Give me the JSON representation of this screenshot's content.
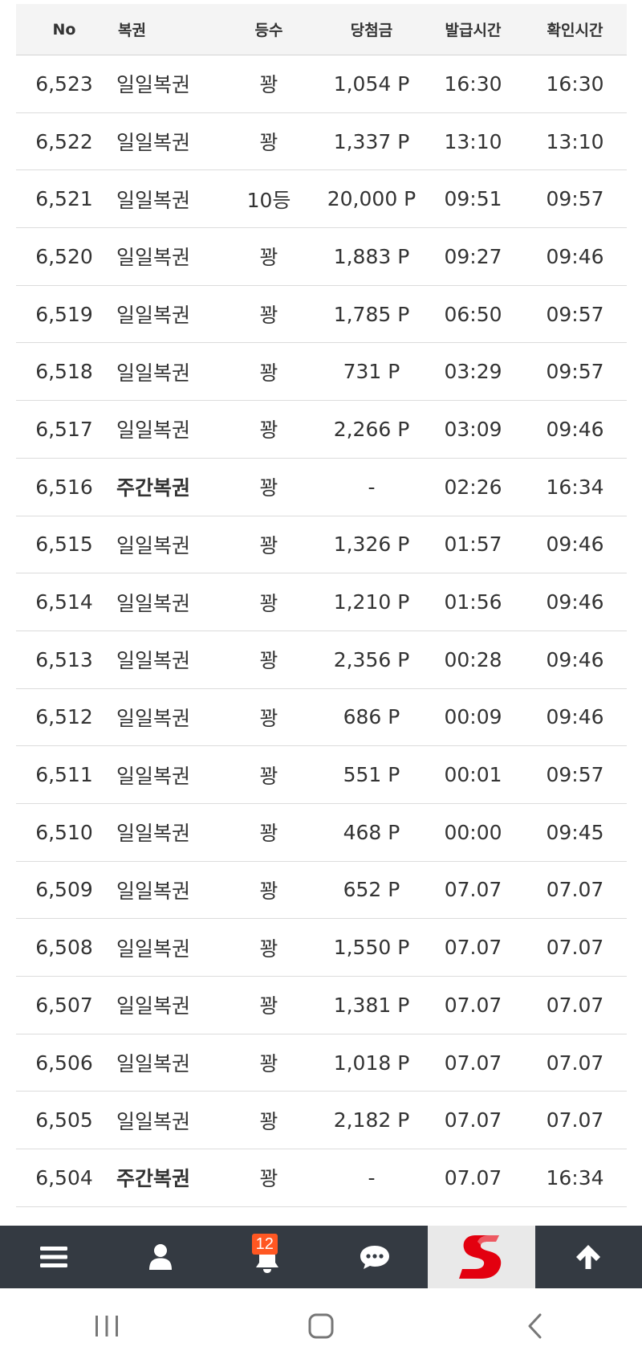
{
  "table": {
    "headers": {
      "no": "No",
      "type": "복권",
      "rank": "등수",
      "prize": "당첨금",
      "issued": "발급시간",
      "checked": "확인시간"
    },
    "rows": [
      {
        "no": "6,523",
        "type": "일일복권",
        "rank": "꽝",
        "prize": "1,054 P",
        "issued": "16:30",
        "checked": "16:30"
      },
      {
        "no": "6,522",
        "type": "일일복권",
        "rank": "꽝",
        "prize": "1,337 P",
        "issued": "13:10",
        "checked": "13:10"
      },
      {
        "no": "6,521",
        "type": "일일복권",
        "rank": "10등",
        "prize": "20,000 P",
        "issued": "09:51",
        "checked": "09:57"
      },
      {
        "no": "6,520",
        "type": "일일복권",
        "rank": "꽝",
        "prize": "1,883 P",
        "issued": "09:27",
        "checked": "09:46"
      },
      {
        "no": "6,519",
        "type": "일일복권",
        "rank": "꽝",
        "prize": "1,785 P",
        "issued": "06:50",
        "checked": "09:57"
      },
      {
        "no": "6,518",
        "type": "일일복권",
        "rank": "꽝",
        "prize": "731 P",
        "issued": "03:29",
        "checked": "09:57"
      },
      {
        "no": "6,517",
        "type": "일일복권",
        "rank": "꽝",
        "prize": "2,266 P",
        "issued": "03:09",
        "checked": "09:46"
      },
      {
        "no": "6,516",
        "type": "주간복권",
        "rank": "꽝",
        "prize": "-",
        "issued": "02:26",
        "checked": "16:34"
      },
      {
        "no": "6,515",
        "type": "일일복권",
        "rank": "꽝",
        "prize": "1,326 P",
        "issued": "01:57",
        "checked": "09:46"
      },
      {
        "no": "6,514",
        "type": "일일복권",
        "rank": "꽝",
        "prize": "1,210 P",
        "issued": "01:56",
        "checked": "09:46"
      },
      {
        "no": "6,513",
        "type": "일일복권",
        "rank": "꽝",
        "prize": "2,356 P",
        "issued": "00:28",
        "checked": "09:46"
      },
      {
        "no": "6,512",
        "type": "일일복권",
        "rank": "꽝",
        "prize": "686 P",
        "issued": "00:09",
        "checked": "09:46"
      },
      {
        "no": "6,511",
        "type": "일일복권",
        "rank": "꽝",
        "prize": "551 P",
        "issued": "00:01",
        "checked": "09:57"
      },
      {
        "no": "6,510",
        "type": "일일복권",
        "rank": "꽝",
        "prize": "468 P",
        "issued": "00:00",
        "checked": "09:45"
      },
      {
        "no": "6,509",
        "type": "일일복권",
        "rank": "꽝",
        "prize": "652 P",
        "issued": "07.07",
        "checked": "07.07"
      },
      {
        "no": "6,508",
        "type": "일일복권",
        "rank": "꽝",
        "prize": "1,550 P",
        "issued": "07.07",
        "checked": "07.07"
      },
      {
        "no": "6,507",
        "type": "일일복권",
        "rank": "꽝",
        "prize": "1,381 P",
        "issued": "07.07",
        "checked": "07.07"
      },
      {
        "no": "6,506",
        "type": "일일복권",
        "rank": "꽝",
        "prize": "1,018 P",
        "issued": "07.07",
        "checked": "07.07"
      },
      {
        "no": "6,505",
        "type": "일일복권",
        "rank": "꽝",
        "prize": "2,182 P",
        "issued": "07.07",
        "checked": "07.07"
      },
      {
        "no": "6,504",
        "type": "주간복권",
        "rank": "꽝",
        "prize": "-",
        "issued": "07.07",
        "checked": "16:34"
      }
    ]
  },
  "bottom_nav": {
    "items": [
      {
        "name": "menu-icon"
      },
      {
        "name": "user-icon"
      },
      {
        "name": "bell-icon",
        "badge": "12"
      },
      {
        "name": "chat-icon"
      },
      {
        "name": "site-logo"
      },
      {
        "name": "arrow-up-icon"
      }
    ],
    "bar_color": "#343a42",
    "badge_color": "#ff5722",
    "logo_color": "#e3000f"
  },
  "system_nav": {
    "items": [
      {
        "name": "recent-apps-icon"
      },
      {
        "name": "home-icon"
      },
      {
        "name": "back-icon"
      }
    ]
  }
}
